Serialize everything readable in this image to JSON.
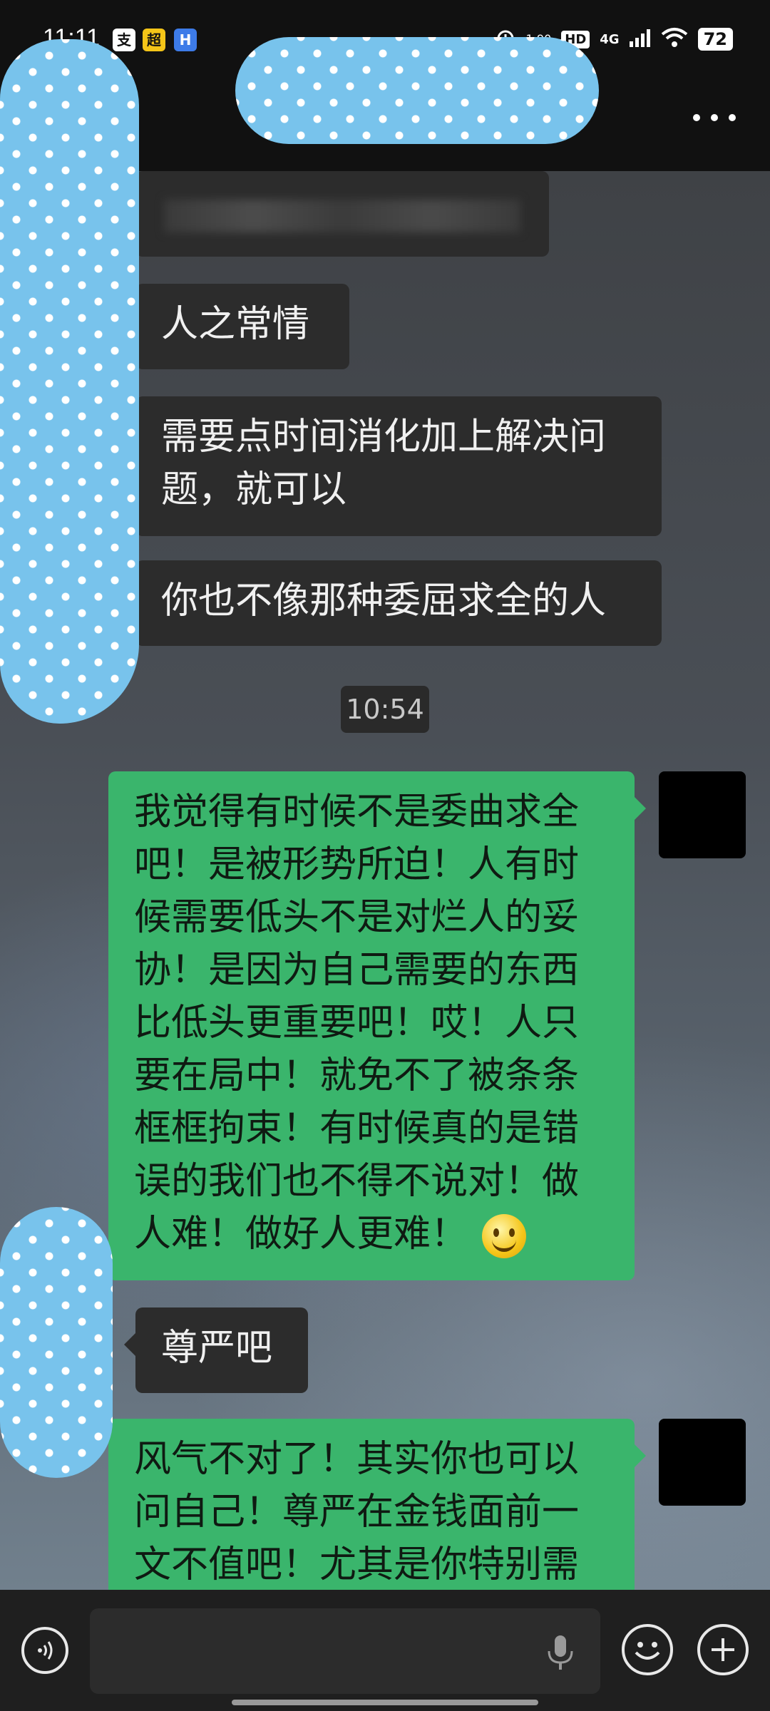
{
  "status_bar": {
    "time": "11:11",
    "app_icons": [
      "支",
      "超",
      "H"
    ],
    "speed": "1.90",
    "hd": "HD",
    "network": "4G",
    "battery": "72"
  },
  "header": {
    "more_icon": "more-dots-icon"
  },
  "messages": [
    {
      "side": "in",
      "text": "人之常情"
    },
    {
      "side": "in",
      "text": "需要点时间消化加上解决问题，就可以"
    },
    {
      "side": "in",
      "text": "你也不像那种委屈求全的人"
    },
    {
      "side": "out",
      "text": "我觉得有时候不是委曲求全吧！是被形势所迫！人有时候需要低头不是对烂人的妥协！是因为自己需要的东西比低头更重要吧！哎！人只要在局中！就免不了被条条框框拘束！有时候真的是错误的我们也不得不说对！做人难！做好人更难！"
    },
    {
      "side": "in",
      "text": "尊严吧"
    },
    {
      "side": "out",
      "text": "风气不对了！其实你也可以问自己！尊严在金钱面前一文不值吧！尤其是你特别需"
    }
  ],
  "timestamp": "10:54",
  "bottom_bar": {
    "voice_icon": "voice-icon",
    "mic_icon": "mic-icon",
    "emoji_icon": "emoji-icon",
    "plus_icon": "plus-icon"
  }
}
